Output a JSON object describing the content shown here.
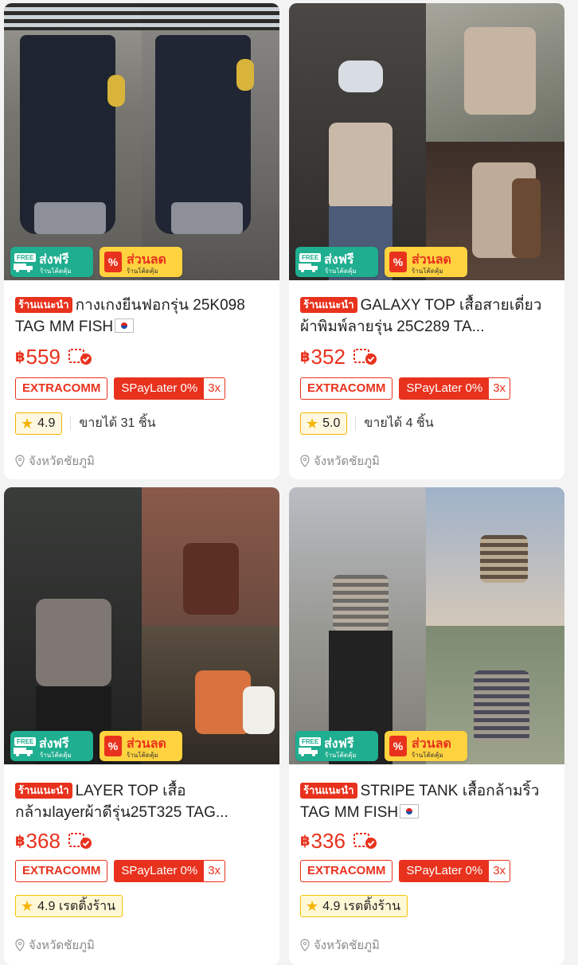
{
  "products": [
    {
      "badge_free_tag": "FREE",
      "badge_free_main": "ส่งฟรี",
      "badge_free_sub": "ร้านโค้ดคุ้ม",
      "badge_disc_main": "ส่วนลด",
      "badge_disc_sub": "ร้านโค้ดคุ้ม",
      "recommended": "ร้านแนะนำ",
      "title": "กางเกงยีนฟอกรุ่น 25K098 TAG MM FISH",
      "currency": "฿",
      "price": "559",
      "extra": "EXTRACOMM",
      "spay": "SPayLater 0%",
      "spay_installments": "3x",
      "rating": "4.9",
      "sold": "ขายได้ 31 ชิ้น",
      "location": "จังหวัดชัยภูมิ"
    },
    {
      "badge_free_tag": "FREE",
      "badge_free_main": "ส่งฟรี",
      "badge_free_sub": "ร้านโค้ดคุ้ม",
      "badge_disc_main": "ส่วนลด",
      "badge_disc_sub": "ร้านโค้ดคุ้ม",
      "recommended": "ร้านแนะนำ",
      "title": "GALAXY TOP เสื้อสายเดี่ยวผ้าพิมพ์ลายรุ่น 25C289 TA...",
      "currency": "฿",
      "price": "352",
      "extra": "EXTRACOMM",
      "spay": "SPayLater 0%",
      "spay_installments": "3x",
      "rating": "5.0",
      "sold": "ขายได้ 4 ชิ้น",
      "location": "จังหวัดชัยภูมิ"
    },
    {
      "badge_free_tag": "FREE",
      "badge_free_main": "ส่งฟรี",
      "badge_free_sub": "ร้านโค้ดคุ้ม",
      "badge_disc_main": "ส่วนลด",
      "badge_disc_sub": "ร้านโค้ดคุ้ม",
      "recommended": "ร้านแนะนำ",
      "title": "LAYER TOP เสื้อกล้ามlayerผ้าดีรุ่น25T325 TAG...",
      "currency": "฿",
      "price": "368",
      "extra": "EXTRACOMM",
      "spay": "SPayLater 0%",
      "spay_installments": "3x",
      "rating": "4.9 เรตติ้งร้าน",
      "location": "จังหวัดชัยภูมิ"
    },
    {
      "badge_free_tag": "FREE",
      "badge_free_main": "ส่งฟรี",
      "badge_free_sub": "ร้านโค้ดคุ้ม",
      "badge_disc_main": "ส่วนลด",
      "badge_disc_sub": "ร้านโค้ดคุ้ม",
      "recommended": "ร้านแนะนำ",
      "title": "STRIPE TANK เสื้อกล้ามริ้ว TAG MM FISH",
      "currency": "฿",
      "price": "336",
      "extra": "EXTRACOMM",
      "spay": "SPayLater 0%",
      "spay_installments": "3x",
      "rating": "4.9 เรตติ้งร้าน",
      "location": "จังหวัดชัยภูมิ"
    }
  ],
  "colors": {
    "accent": "#e8321d",
    "free_badge": "#1fae8f",
    "discount_badge": "#ffd23f",
    "rating_star": "#f5b400"
  },
  "icons": [
    "star-icon",
    "location-pin-icon",
    "coupon-check-icon",
    "korea-flag-icon",
    "truck-icon",
    "percent-icon"
  ]
}
